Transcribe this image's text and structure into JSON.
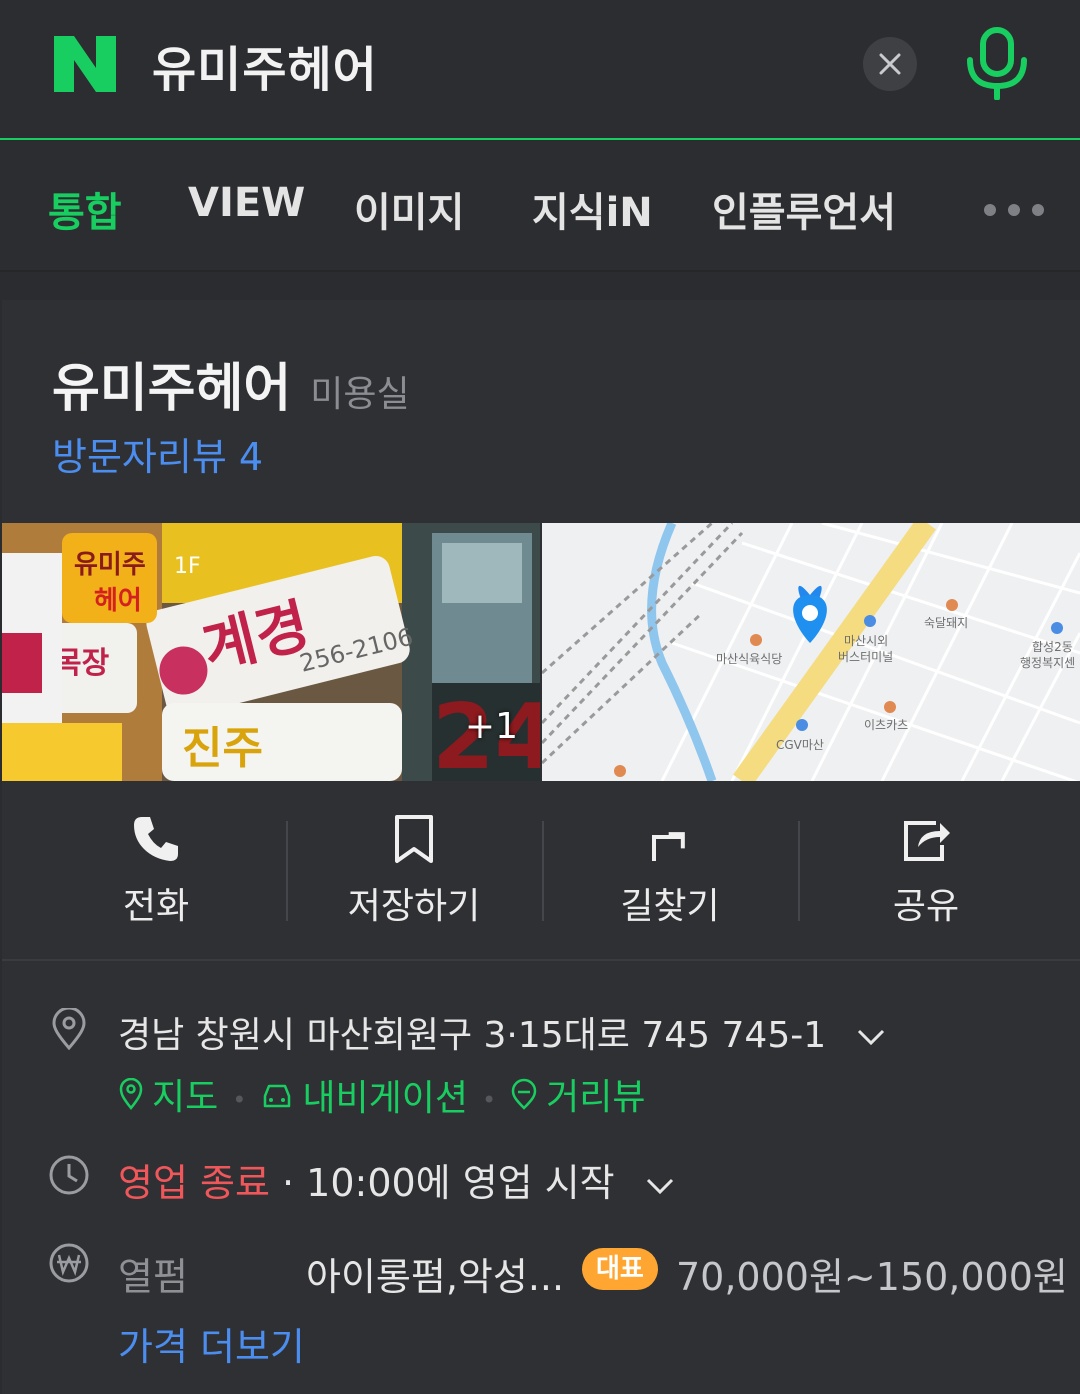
{
  "search": {
    "logo_letter": "N",
    "query": "유미주헤어",
    "brand_color": "#19ce60"
  },
  "tabs": [
    {
      "label": "통합",
      "active": true
    },
    {
      "label": "VIEW",
      "active": false
    },
    {
      "label": "이미지",
      "active": false
    },
    {
      "label": "지식iN",
      "active": false
    },
    {
      "label": "인플루언서",
      "active": false
    }
  ],
  "place": {
    "name": "유미주헤어",
    "category": "미용실",
    "reviews": "방문자리뷰 4",
    "photo_more": "+1",
    "map_labels": {
      "poi1": "마산식육식당",
      "poi2": "마산시외",
      "poi2b": "버스터미널",
      "poi3": "숙달돼지",
      "poi4": "합성2동",
      "poi4b": "행정복지센",
      "poi5": "이츠카츠",
      "poi6": "CGV마산"
    },
    "sign_text": {
      "store1": "유미주",
      "store1b": "헤어",
      "phone": "256-2106",
      "floor": "1F",
      "number": "24"
    }
  },
  "actions": [
    {
      "label": "전화",
      "icon": "phone-icon"
    },
    {
      "label": "저장하기",
      "icon": "bookmark-icon"
    },
    {
      "label": "길찾기",
      "icon": "directions-icon"
    },
    {
      "label": "공유",
      "icon": "share-icon"
    }
  ],
  "info": {
    "address": "경남 창원시 마산회원구 3·15대로 745 745-1",
    "links": [
      "지도",
      "내비게이션",
      "거리뷰"
    ],
    "status": "영업 종료",
    "hours": "· 10:00에 영업 시작",
    "price_name": "열펌",
    "price_desc": "아이롱펌,악성...",
    "price_badge": "대표",
    "price_value": "70,000원~150,000원",
    "more_price": "가격 더보기"
  },
  "colors": {
    "accent_green": "#19ce60",
    "link_blue": "#4b8ef0",
    "closed_red": "#f0575b",
    "badge_orange": "#ffa632"
  }
}
